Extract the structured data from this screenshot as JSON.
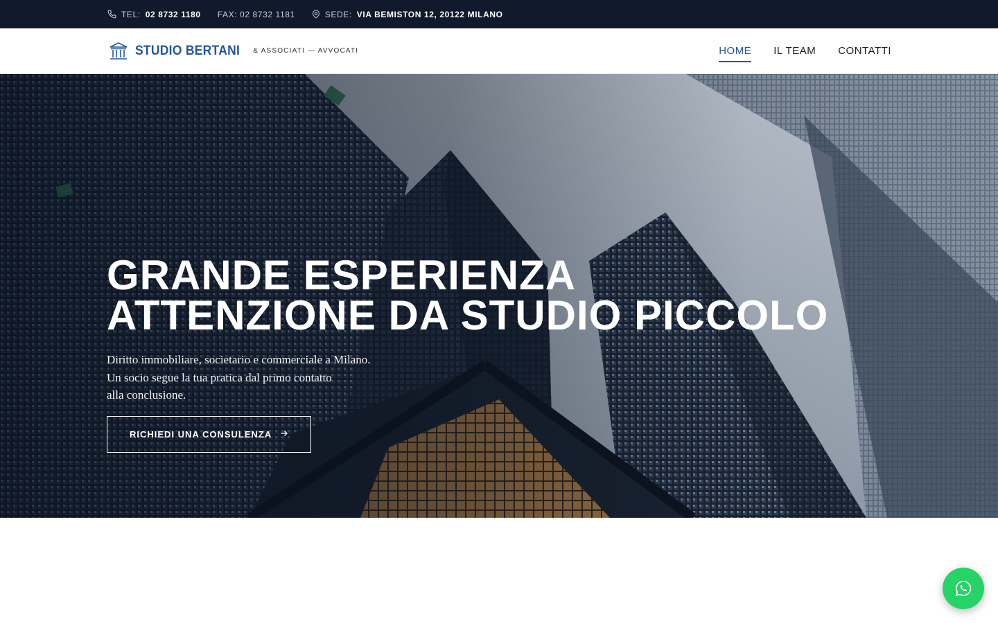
{
  "topbar": {
    "tel_label": "TEL:",
    "tel_value": "02 8732 1180",
    "fax_text": "FAX: 02 8732 1181",
    "address_label": "SEDE:",
    "address_value": "VIA BEMISTON 12, 20122 MILANO"
  },
  "brand": {
    "name": "STUDIO BERTANI",
    "tagline": "& ASSOCIATI — AVVOCATI",
    "icon": "courthouse-icon",
    "color": "#23569a"
  },
  "nav": {
    "items": [
      {
        "label": "HOME",
        "active": true
      },
      {
        "label": "IL TEAM",
        "active": false
      },
      {
        "label": "CONTATTI",
        "active": false
      }
    ]
  },
  "hero": {
    "title_line1": "GRANDE ESPERIENZA",
    "title_line2": "ATTENZIONE DA STUDIO PICCOLO",
    "text_line1": "Diritto immobiliare, societario e commerciale a Milano.",
    "text_line2": "Un socio segue la tua pratica dal primo contatto",
    "text_line3": "alla conclusione.",
    "cta_label": "RICHIEDI UNA CONSULENZA",
    "cta_icon": "arrow-right-icon",
    "background": "skyscrapers-photo"
  },
  "floating": {
    "icon": "whatsapp-icon",
    "color": "#25d366"
  },
  "colors": {
    "topbar_bg": "#111a2c",
    "accent": "#23569a"
  }
}
